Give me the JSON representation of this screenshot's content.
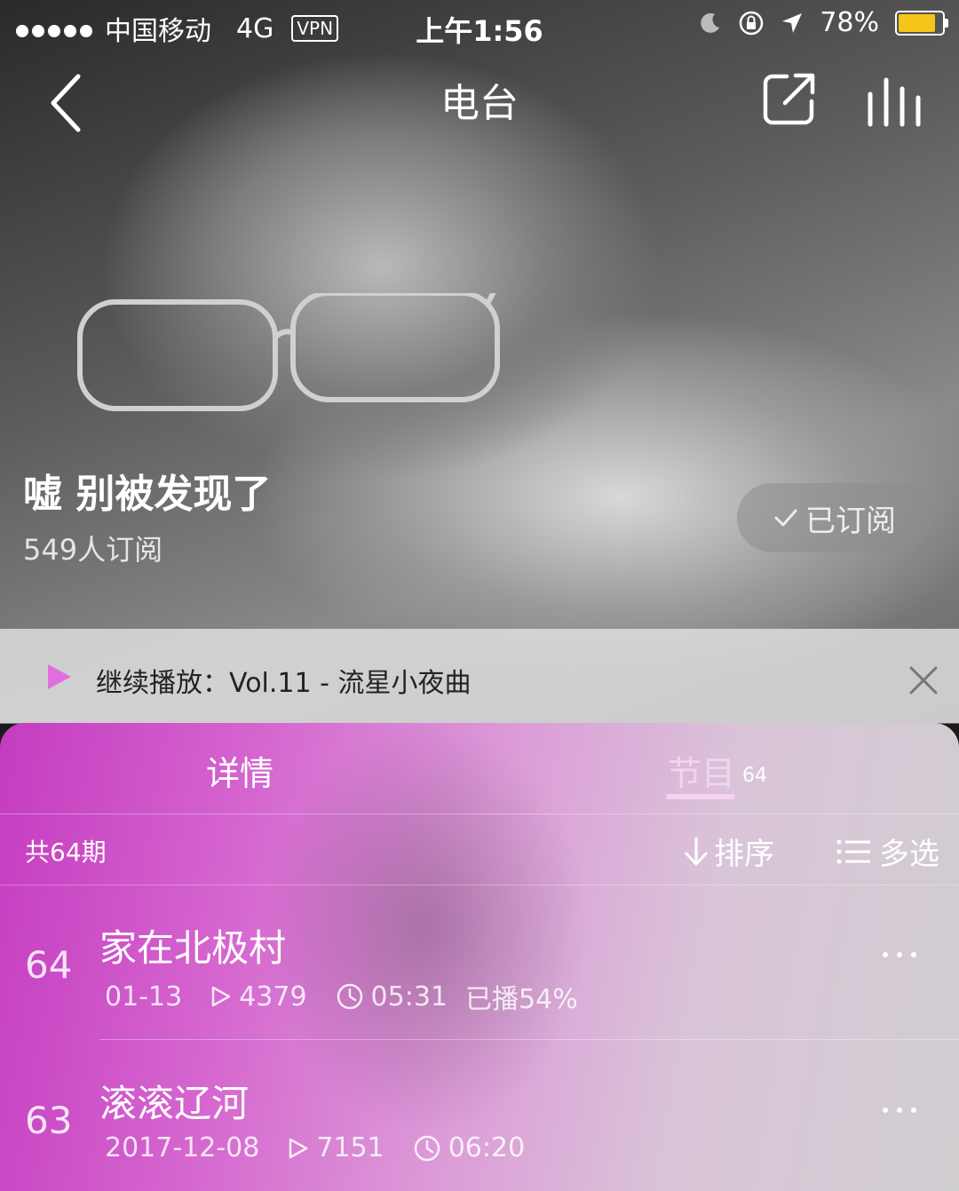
{
  "status_bar": {
    "carrier": "中国移动",
    "network": "4G",
    "vpn": "VPN",
    "time": "上午1:56",
    "battery_percent": "78%",
    "battery_level": 0.78,
    "battery_color": "#f5c518"
  },
  "nav": {
    "title": "电台",
    "icons": [
      "back-icon",
      "share-icon",
      "now-playing-icon"
    ]
  },
  "radio": {
    "title": "嘘 别被发现了",
    "subscribers": "549人订阅",
    "subscribe_button": "已订阅"
  },
  "resume": {
    "label": "继续播放：Vol.11 - 流星小夜曲"
  },
  "tabs": {
    "detail": "详情",
    "programs": "节目",
    "programs_count": "64"
  },
  "toolbar": {
    "total": "共64期",
    "sort": "排序",
    "multi_select": "多选"
  },
  "episodes": [
    {
      "number": "64",
      "title": "家在北极村",
      "date": "01-13",
      "plays": "4379",
      "duration": "05:31",
      "progress": "已播54%"
    },
    {
      "number": "63",
      "title": "滚滚辽河",
      "date": "2017-12-08",
      "plays": "7151",
      "duration": "06:20"
    }
  ],
  "colors": {
    "accent": "#c43cc0",
    "tab_active": "#f6d2f2",
    "play_icon": "#e070e0"
  }
}
